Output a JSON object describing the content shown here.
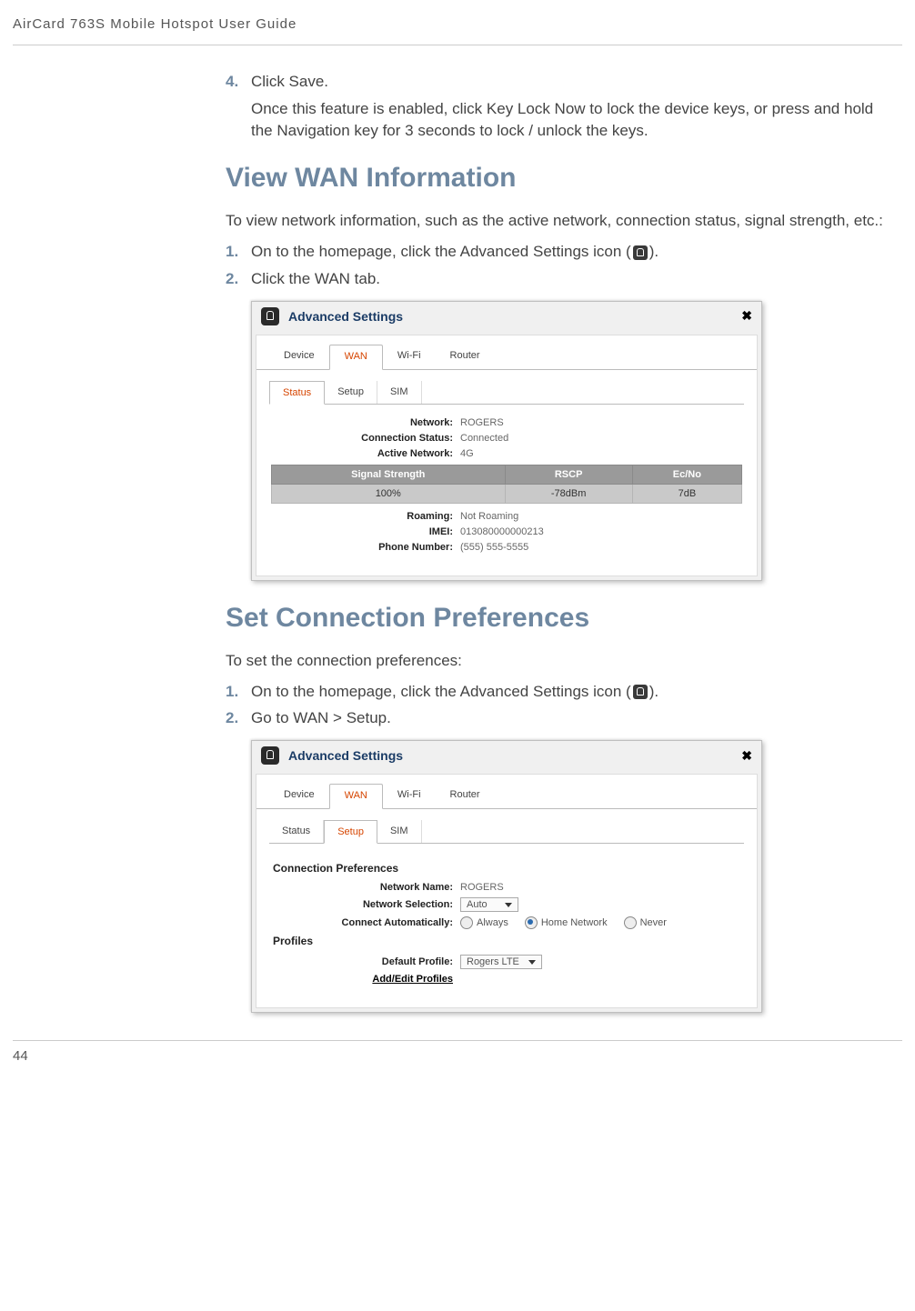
{
  "header": {
    "running_title": "AirCard 763S Mobile Hotspot User Guide"
  },
  "page_number": "44",
  "sections": {
    "prior_step": {
      "num": "4.",
      "text": "Click Save.",
      "followup": "Once this feature is enabled, click Key Lock Now to lock the device keys, or press and hold the Navigation key for 3 seconds to lock / unlock the keys."
    },
    "view_wan": {
      "heading": "View WAN Information",
      "intro": "To view network information, such as the active network, connection status, signal strength, etc.:",
      "steps": [
        {
          "num": "1.",
          "text_a": "On to the homepage, click the Advanced Settings icon (",
          "text_b": ")."
        },
        {
          "num": "2.",
          "text": "Click the WAN tab."
        }
      ]
    },
    "set_conn": {
      "heading": "Set Connection Preferences",
      "intro": "To set the connection preferences:",
      "steps": [
        {
          "num": "1.",
          "text_a": "On to the homepage, click the Advanced Settings icon (",
          "text_b": ")."
        },
        {
          "num": "2.",
          "text": "Go to WAN > Setup."
        }
      ]
    }
  },
  "screenshot1": {
    "title": "Advanced Settings",
    "close": "✖",
    "main_tabs": [
      "Device",
      "WAN",
      "Wi-Fi",
      "Router"
    ],
    "active_main": "WAN",
    "sub_tabs": [
      "Status",
      "Setup",
      "SIM"
    ],
    "active_sub": "Status",
    "fields": {
      "network_label": "Network:",
      "network_value": "ROGERS",
      "conn_status_label": "Connection Status:",
      "conn_status_value": "Connected",
      "active_network_label": "Active Network:",
      "active_network_value": "4G",
      "roaming_label": "Roaming:",
      "roaming_value": "Not Roaming",
      "imei_label": "IMEI:",
      "imei_value": "013080000000213",
      "phone_label": "Phone Number:",
      "phone_value": "(555) 555-5555"
    },
    "signal_table": {
      "headers": [
        "Signal Strength",
        "RSCP",
        "Ec/No"
      ],
      "row": [
        "100%",
        "-78dBm",
        "7dB"
      ]
    }
  },
  "screenshot2": {
    "title": "Advanced Settings",
    "close": "✖",
    "main_tabs": [
      "Device",
      "WAN",
      "Wi-Fi",
      "Router"
    ],
    "active_main": "WAN",
    "sub_tabs": [
      "Status",
      "Setup",
      "SIM"
    ],
    "active_sub": "Setup",
    "conn_pref_heading": "Connection Preferences",
    "profiles_heading": "Profiles",
    "fields": {
      "net_name_label": "Network Name:",
      "net_name_value": "ROGERS",
      "net_sel_label": "Network Selection:",
      "net_sel_value": "Auto",
      "conn_auto_label": "Connect Automatically:",
      "radios": [
        "Always",
        "Home Network",
        "Never"
      ],
      "radio_selected": "Home Network",
      "def_profile_label": "Default Profile:",
      "def_profile_value": "Rogers LTE",
      "edit_profiles": "Add/Edit Profiles"
    }
  }
}
